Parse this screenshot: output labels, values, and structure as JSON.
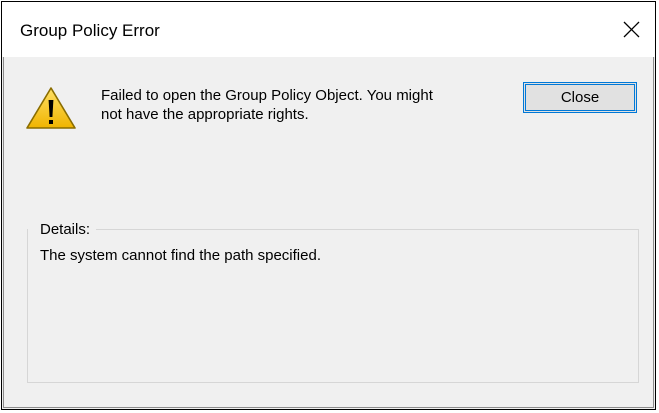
{
  "window": {
    "title": "Group Policy Error",
    "close_glyph": "✕",
    "title_bg": "#ffffff",
    "body_bg": "#f0f0f0"
  },
  "icon": {
    "name": "warning-icon",
    "fill": "#f5c518",
    "stroke": "#8a6d00"
  },
  "message": {
    "line1": "Failed to open the Group Policy Object.  You might",
    "line2": "not have the appropriate rights."
  },
  "buttons": {
    "close_label": "Close",
    "accent": "#0078d7"
  },
  "details": {
    "label": "Details:",
    "text": "The system cannot find the path specified."
  }
}
